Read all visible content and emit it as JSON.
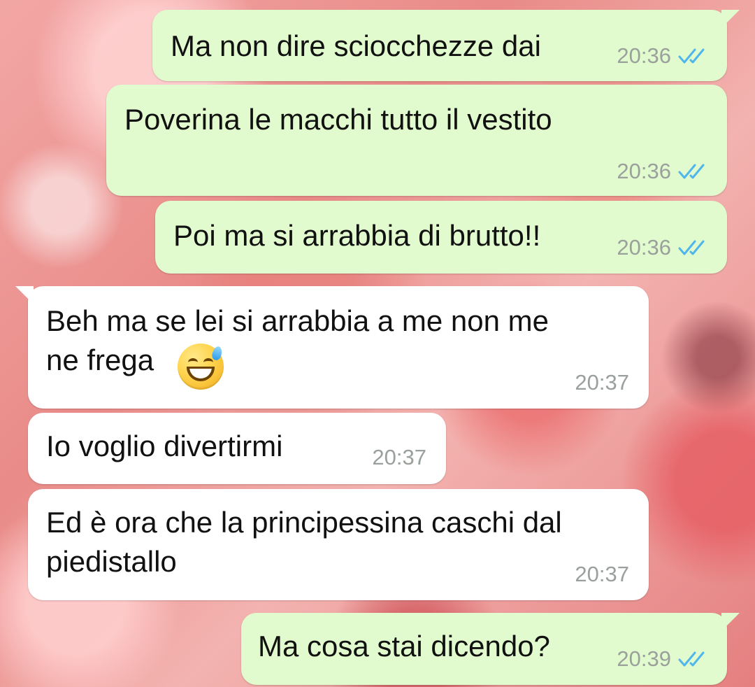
{
  "chat": {
    "messages": [
      {
        "text": "Ma non dire sciocchezze dai",
        "time": "20:36",
        "direction": "outgoing",
        "status": "read-double-check-icon"
      },
      {
        "text": "Poverina le macchi tutto il vestito",
        "time": "20:36",
        "direction": "outgoing",
        "status": "read-double-check-icon"
      },
      {
        "text": "Poi ma si arrabbia di brutto!!",
        "time": "20:36",
        "direction": "outgoing",
        "status": "read-double-check-icon"
      },
      {
        "text": "Beh ma se lei si arrabbia a me non me\nne frega",
        "time": "20:37",
        "direction": "incoming",
        "emoji": "grinning-face-with-sweat-emoji"
      },
      {
        "text": "Io voglio divertirmi",
        "time": "20:37",
        "direction": "incoming"
      },
      {
        "text": "Ed è ora che la principessina caschi dal\npiedistallo",
        "time": "20:37",
        "direction": "incoming"
      },
      {
        "text": "Ma cosa stai dicendo?",
        "time": "20:39",
        "direction": "outgoing",
        "status": "read-double-check-icon"
      }
    ]
  },
  "colors": {
    "outgoing_bubble": "#e2fbce",
    "incoming_bubble": "#ffffff",
    "timestamp": "#9aa09b",
    "read_ticks": "#4fb6ec",
    "background": "#e98b88"
  }
}
